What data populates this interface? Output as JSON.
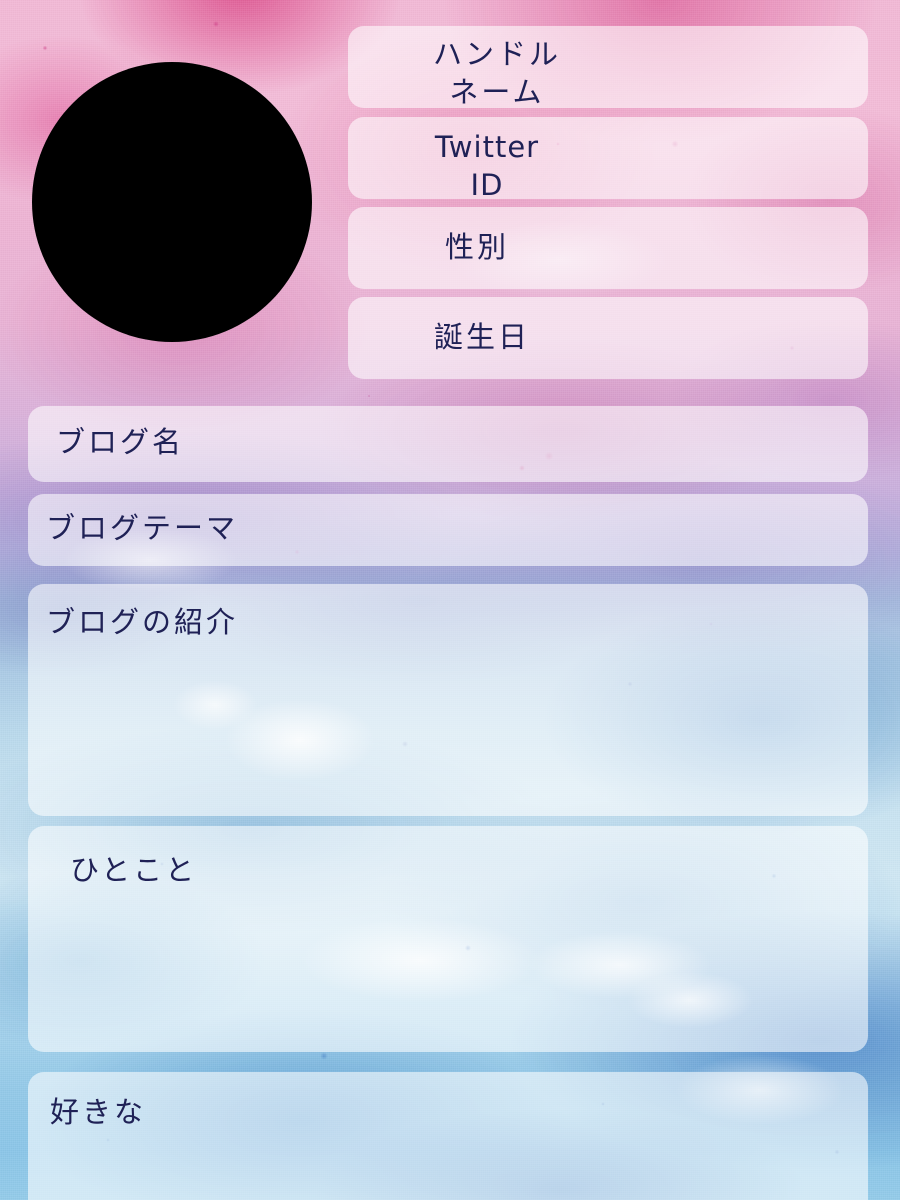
{
  "card": {
    "title": "profile-card-template",
    "language": "ja",
    "text_color": "#1f2156",
    "field_fill": "rgba(255,255,255,0.58)",
    "background": {
      "style": "watercolor",
      "top_color": "#f2b9d6",
      "mid_color": "#b7b4df",
      "bottom_color": "#8bc6e8"
    }
  },
  "avatar": {
    "shape": "circle",
    "color": "#000000",
    "label": "avatar-placeholder"
  },
  "fields": {
    "handle_name": "ハンドル\nネーム",
    "twitter_id": "Twitter\nID",
    "gender": "性別",
    "birthday": "誕生日",
    "blog_name": "ブログ名",
    "blog_theme": "ブログテーマ",
    "blog_intro": "ブログの紹介",
    "hitokoto": "ひとこと",
    "favorite": "好きな"
  }
}
